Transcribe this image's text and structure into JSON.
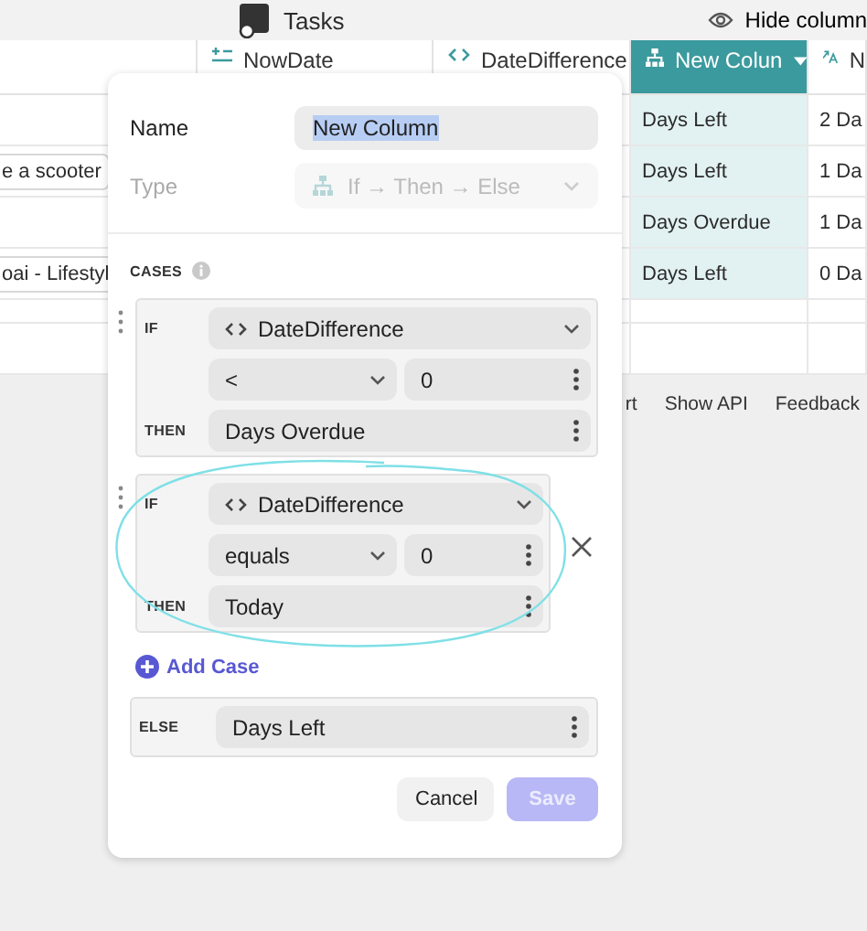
{
  "app_bar": {
    "title": "Tasks",
    "action": "Hide column"
  },
  "table": {
    "columns": [
      {
        "label": "NowDate",
        "kind": "number",
        "selected": false
      },
      {
        "label": "DateDifference",
        "kind": "code",
        "selected": false
      },
      {
        "label": "New Colun",
        "kind": "conditional",
        "selected": true
      },
      {
        "label": "N",
        "kind": "text",
        "selected": false
      }
    ],
    "rows": [
      {
        "result": "Days Left",
        "column_5": "2 Da"
      },
      {
        "column_1": "e a scooter",
        "result": "Days Left",
        "column_5": "1 Da"
      },
      {
        "result": "Days Overdue",
        "column_5": "1 Da"
      },
      {
        "column_1": "oai - Lifestyl",
        "result": "Days Left",
        "column_5": "0 Da"
      }
    ]
  },
  "footer_links": [
    "rt",
    "Show API",
    "Feedback"
  ],
  "editor": {
    "name_label": "Name",
    "name_value": "New Column",
    "name_highlighted": true,
    "type_label": "Type",
    "type_value": "If → Then → Else",
    "type_disabled": true,
    "cases_label": "CASES",
    "cases": [
      {
        "if_label": "IF",
        "field": "DateDifference",
        "operator": "<",
        "value": "0",
        "then_label": "THEN",
        "result": "Days Overdue",
        "removable": false,
        "circled": false
      },
      {
        "if_label": "IF",
        "field": "DateDifference",
        "operator": "equals",
        "value": "0",
        "then_label": "THEN",
        "result": "Today",
        "removable": true,
        "circled": true
      }
    ],
    "add_case": "Add Case",
    "else_label": "ELSE",
    "else_value": "Days Left",
    "buttons": [
      {
        "label": "Cancel",
        "kind": "secondary",
        "disabled": false
      },
      {
        "label": "Save",
        "kind": "primary",
        "disabled": true
      }
    ]
  }
}
